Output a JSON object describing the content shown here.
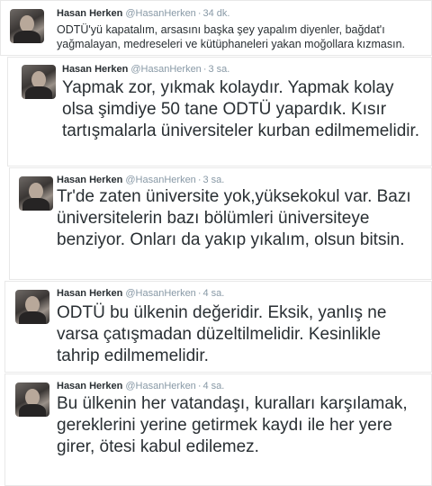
{
  "tweets": [
    {
      "name": "Hasan Herken",
      "handle": "@HasanHerken",
      "separator": "·",
      "time": "34 dk.",
      "text": "ODTÜ'yü kapatalım, arsasını başka şey yapalım diyenler, bağdat'ı yağmalayan, medreseleri ve kütüphaneleri yakan moğollara kızmasın."
    },
    {
      "name": "Hasan Herken",
      "handle": "@HasanHerken",
      "separator": "·",
      "time": "3 sa.",
      "text": "Yapmak zor, yıkmak kolaydır. Yapmak kolay olsa şimdiye 50 tane ODTÜ yapardık. Kısır tartışmalarla üniversiteler kurban edilmemelidir."
    },
    {
      "name": "Hasan Herken",
      "handle": "@HasanHerken",
      "separator": "·",
      "time": "3 sa.",
      "text": "Tr'de zaten üniversite yok,yüksekokul var. Bazı üniversitelerin bazı bölümleri üniversiteye benziyor. Onları da yakıp yıkalım, olsun bitsin."
    },
    {
      "name": "Hasan Herken",
      "handle": "@HasanHerken",
      "separator": "·",
      "time": "4 sa.",
      "text": "ODTÜ bu ülkenin değeridir. Eksik, yanlış ne varsa çatışmadan düzeltilmelidir. Kesinlikle tahrip edilmemelidir."
    },
    {
      "name": "Hasan Herken",
      "handle": "@HasanHerken",
      "separator": "·",
      "time": "4 sa.",
      "text": "Bu ülkenin her vatandaşı, kuralları karşılamak, gereklerini yerine getirmek kaydı ile her yere girer, ötesi kabul edilemez."
    }
  ]
}
